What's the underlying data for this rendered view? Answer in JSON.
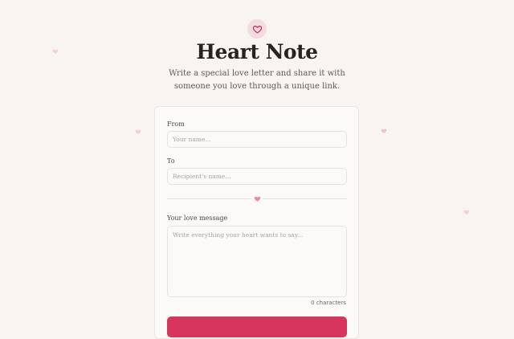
{
  "app": {
    "title": "Heart Note",
    "subtitle": "Write a special love letter and share it with someone you love through a unique link."
  },
  "form": {
    "from_label": "From",
    "from_placeholder": "Your name...",
    "from_value": "",
    "to_label": "To",
    "to_placeholder": "Recipient's name...",
    "to_value": "",
    "message_label": "Your love message",
    "message_placeholder": "Write everything your heart wants to say...",
    "message_value": "",
    "char_count": "0 characters",
    "submit_label": ""
  },
  "icons": {
    "logo": "heart-outline-icon",
    "divider": "heart-icon",
    "decor": "heart-icon"
  },
  "colors": {
    "background": "#f8f4f1",
    "accent": "#d6345a",
    "logo_badge": "#f3dcdf",
    "decor_heart": "#f0c4cd"
  }
}
